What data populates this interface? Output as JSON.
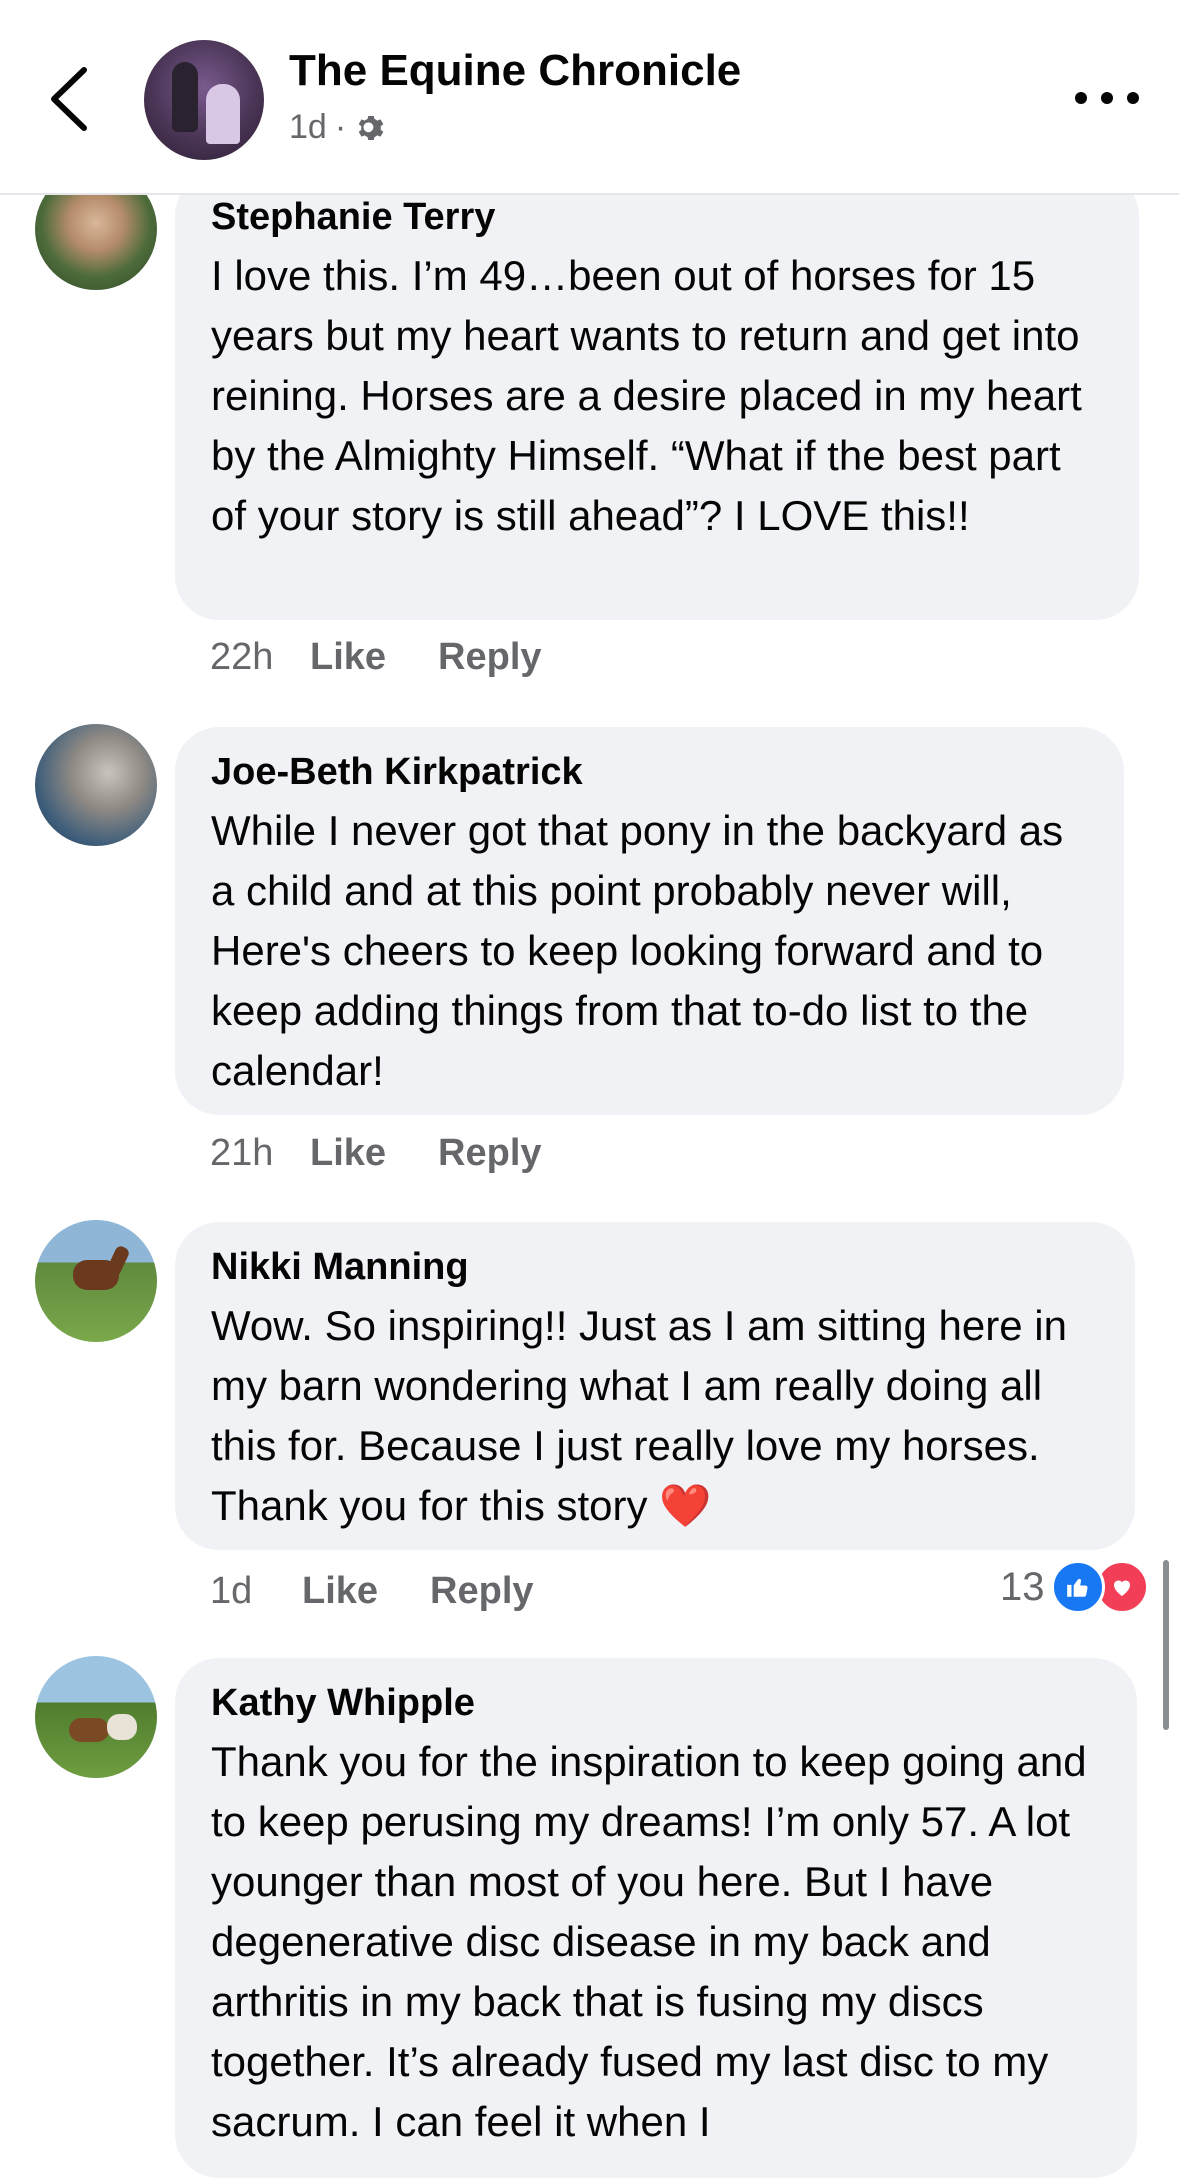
{
  "header": {
    "title": "The Equine Chronicle",
    "time": "1d",
    "separator": "·"
  },
  "comments": [
    {
      "author": "Stephanie Terry",
      "text": "I love this.  I’m 49…been out of horses for 15 years but my heart wants to return and get into reining.  Horses are a desire placed in my heart by the Almighty Himself.  “What if the best part of your story is still ahead”? I LOVE this!!",
      "time": "22h",
      "like": "Like",
      "reply": "Reply"
    },
    {
      "author": "Joe-Beth Kirkpatrick",
      "text": "While I never got that pony in the backyard as a child and at this point probably never will, Here's cheers to keep looking forward and to keep adding things from that to-do list to the calendar!",
      "time": "21h",
      "like": "Like",
      "reply": "Reply"
    },
    {
      "author": "Nikki Manning",
      "text": "Wow. So inspiring!! Just as I am sitting here in my barn wondering what I am really doing all this for. Because I just really love my horses. Thank you for this story",
      "emoji": "❤️",
      "time": "1d",
      "like": "Like",
      "reply": "Reply",
      "reaction_count": "13"
    },
    {
      "author": "Kathy Whipple",
      "text": "Thank you for the inspiration to keep going and to keep perusing my dreams! I’m only 57. A lot younger than most of you here. But I have degenerative disc disease in my back and arthritis in my back that is fusing my discs together. It’s already fused my last disc to my sacrum. I can feel it when I"
    }
  ],
  "colors": {
    "bubble": "#f0f2f5",
    "meta_text": "#65676b",
    "like_blue": "#1877f2",
    "love_red": "#f33e58"
  },
  "icons": [
    "back-arrow-icon",
    "gear-icon",
    "more-icon",
    "like-reaction-icon",
    "love-reaction-icon"
  ]
}
